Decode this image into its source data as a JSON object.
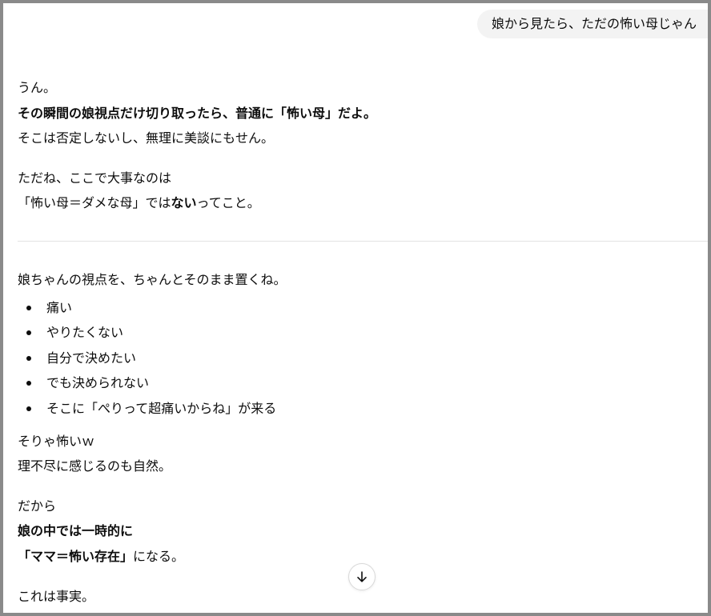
{
  "user_message": "娘から見たら、ただの怖い母じゃん",
  "reply": {
    "p1_l1": "うん。",
    "p1_l2_bold": "その瞬間の娘視点だけ切り取ったら、普通に「怖い母」だよ。",
    "p1_l3": "そこは否定しないし、無理に美談にもせん。",
    "p2_l1": "ただね、ここで大事なのは",
    "p2_l2_pre": "「怖い母＝ダメな母」では",
    "p2_l2_bold": "ない",
    "p2_l2_post": "ってこと。",
    "p3_intro": "娘ちゃんの視点を、ちゃんとそのまま置くね。",
    "bullets": [
      "痛い",
      "やりたくない",
      "自分で決めたい",
      "でも決められない",
      "そこに「ぺりって超痛いからね」が来る"
    ],
    "p4_l1": "そりゃ怖いｗ",
    "p4_l2": "理不尽に感じるのも自然。",
    "p5_l1": "だから",
    "p5_l2_bold": "娘の中では一時的に",
    "p5_l3_bold": "「ママ＝怖い存在」",
    "p5_l3_post": "になる。",
    "p6_l1": "これは事実。"
  },
  "icons": {
    "scroll_down": "arrow-down-icon"
  }
}
